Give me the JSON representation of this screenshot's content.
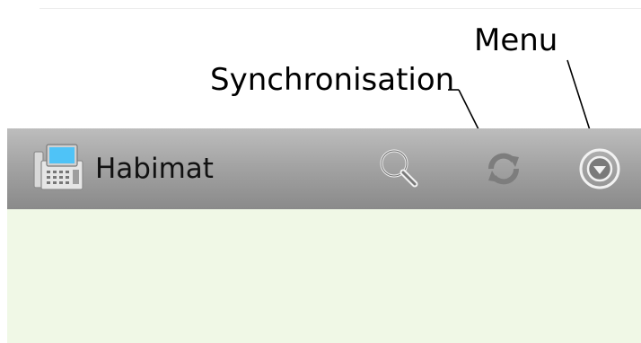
{
  "annotations": {
    "menu_label": "Menu",
    "sync_label": "Synchronisation"
  },
  "app_bar": {
    "title": "Habimat",
    "app_icon": "phone-terminal-icon",
    "actions": [
      {
        "name": "search",
        "icon": "search-icon"
      },
      {
        "name": "sync",
        "icon": "sync-icon"
      },
      {
        "name": "menu",
        "icon": "chevron-down-circle-icon"
      }
    ]
  },
  "colors": {
    "app_bar_top": "#bdbdbd",
    "app_bar_bottom": "#8a8a8a",
    "content_background": "#f0f8e6",
    "icon_stroke": "#f2f2f2"
  }
}
